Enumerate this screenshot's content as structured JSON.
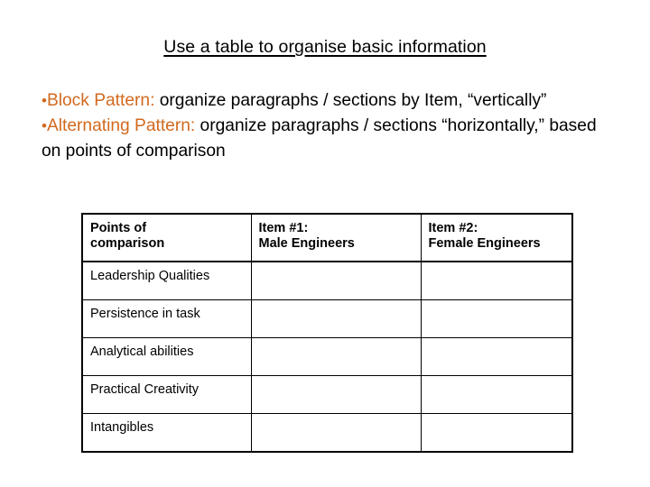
{
  "slide": {
    "title": "Use a table to organise basic information",
    "background_color": "#FFFFFF",
    "accent_color": "#D2691E",
    "text_color": "#000000"
  },
  "bullets": [
    {
      "marker": "•",
      "lead_in": "Block Pattern:",
      "rest": " organize paragraphs / sections by Item, “vertically”"
    },
    {
      "marker": "•",
      "lead_in": "Alternating Pattern:",
      "rest": "  organize paragraphs / sections “horizontally,” based on points of comparison"
    }
  ],
  "table": {
    "headers": [
      {
        "line1": "Points of",
        "line2": "comparison"
      },
      {
        "line1": "Item #1:",
        "line2": "Male Engineers"
      },
      {
        "line1": "Item #2:",
        "line2": "Female Engineers"
      }
    ],
    "rows": [
      {
        "point": "Leadership Qualities",
        "item1": "",
        "item2": ""
      },
      {
        "point": "Persistence in task",
        "item1": "",
        "item2": ""
      },
      {
        "point": "Analytical abilities",
        "item1": "",
        "item2": ""
      },
      {
        "point": "Practical Creativity",
        "item1": "",
        "item2": ""
      },
      {
        "point": "Intangibles",
        "item1": "",
        "item2": ""
      }
    ]
  }
}
